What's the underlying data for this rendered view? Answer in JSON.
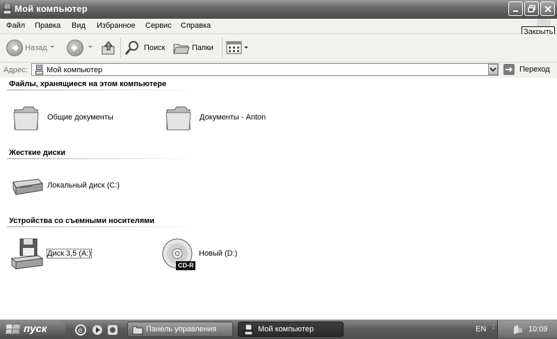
{
  "window": {
    "title": "Мой компьютер",
    "tooltip": "Закрыть"
  },
  "menu": [
    "Файл",
    "Правка",
    "Вид",
    "Избранное",
    "Сервис",
    "Справка"
  ],
  "toolbar": {
    "back_label": "Назад",
    "search_label": "Поиск",
    "folders_label": "Папки"
  },
  "address": {
    "label": "Адрес:",
    "value": "Мой компьютер",
    "go_label": "Переход"
  },
  "sections": {
    "files": {
      "title": "Файлы, хранящиеся на этом компьютере",
      "items": [
        {
          "label": "Общие документы",
          "icon": "folder-icon"
        },
        {
          "label": "Документы - Anton",
          "icon": "folder-icon"
        }
      ]
    },
    "drives": {
      "title": "Жесткие диски",
      "items": [
        {
          "label": "Локальный диск (C:)",
          "icon": "hard-drive-icon"
        }
      ]
    },
    "removable": {
      "title": "Устройства со съемными носителями",
      "items": [
        {
          "label": "Диск 3,5 (A:)",
          "icon": "floppy-drive-icon"
        },
        {
          "label": "Новый (D:)",
          "icon": "cd-drive-icon",
          "badge": "CD-R"
        }
      ]
    }
  },
  "taskbar": {
    "start_label": "пуск",
    "tasks": [
      {
        "label": "Панель управления",
        "active": false
      },
      {
        "label": "Мой компьютер",
        "active": true
      }
    ],
    "lang": "EN",
    "clock": "10:09"
  }
}
